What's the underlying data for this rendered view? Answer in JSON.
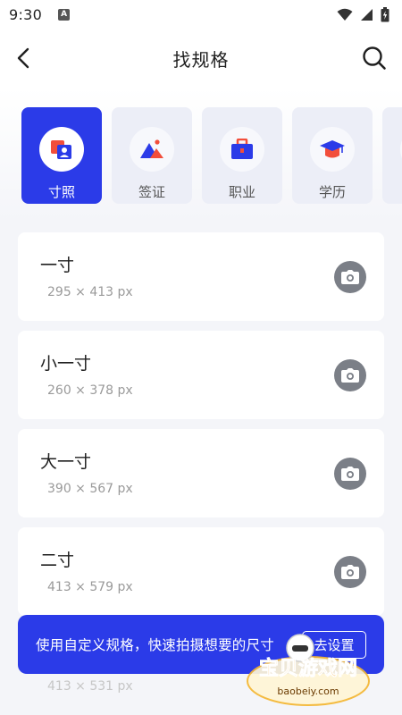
{
  "status_bar": {
    "time": "9:30"
  },
  "header": {
    "title": "找规格"
  },
  "categories": [
    {
      "label": "寸照",
      "icon": "id-photo-icon",
      "active": true
    },
    {
      "label": "签证",
      "icon": "mountain-icon",
      "active": false
    },
    {
      "label": "职业",
      "icon": "briefcase-icon",
      "active": false
    },
    {
      "label": "学历",
      "icon": "graduation-cap-icon",
      "active": false
    }
  ],
  "specs": [
    {
      "name": "一寸",
      "size": "295 × 413 px"
    },
    {
      "name": "小一寸",
      "size": "260 × 378 px"
    },
    {
      "name": "大一寸",
      "size": "390 × 567 px"
    },
    {
      "name": "二寸",
      "size": "413 × 579 px"
    },
    {
      "size": "413 × 531 px"
    }
  ],
  "banner": {
    "text": "使用自定义规格，快速拍摄想要的尺寸",
    "button_label": "去设置"
  },
  "watermark": {
    "title": "宝贝游戏网",
    "url": "baobeiy.com"
  },
  "colors": {
    "accent": "#2b3be8",
    "background": "#f4f5f9",
    "camera": "#7b7f87"
  }
}
